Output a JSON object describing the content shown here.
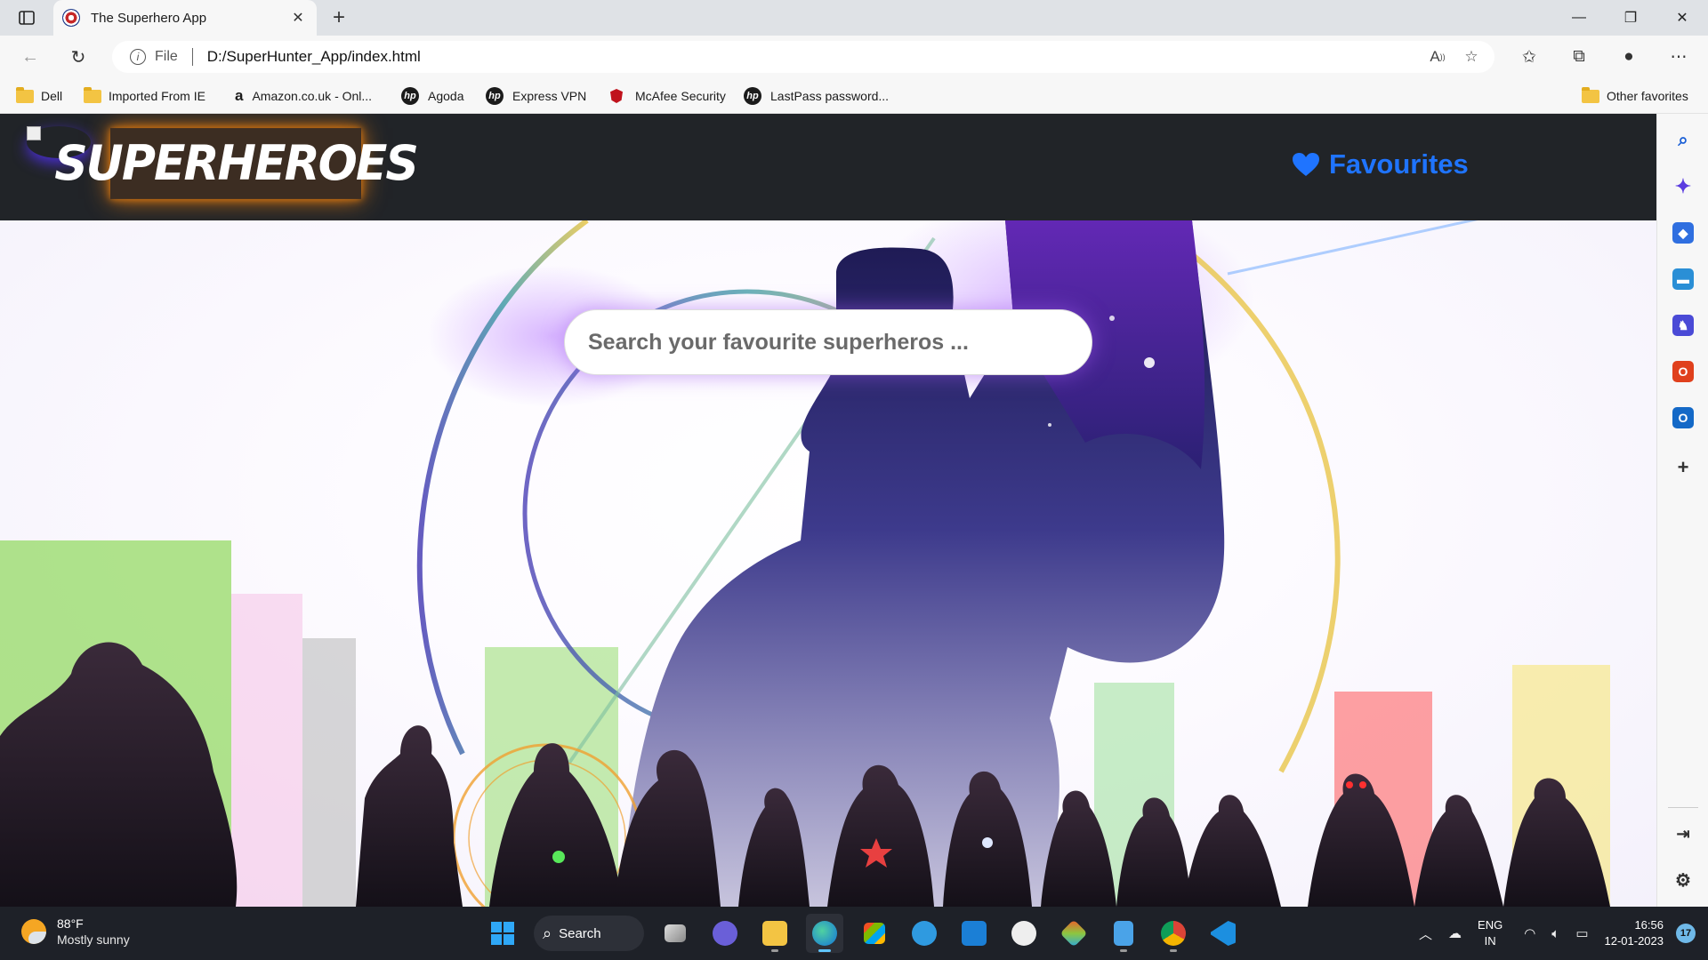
{
  "browser": {
    "tab": {
      "title": "The Superhero App"
    },
    "address": {
      "scheme": "File",
      "url": "D:/SuperHunter_App/index.html"
    },
    "favorites": [
      {
        "label": "Dell",
        "icon": "folder-icon"
      },
      {
        "label": "Imported From IE",
        "icon": "folder-icon"
      },
      {
        "label": "Amazon.co.uk - Onl...",
        "icon": "amazon-icon"
      },
      {
        "label": "Agoda",
        "icon": "hp-icon"
      },
      {
        "label": "Express VPN",
        "icon": "hp-icon"
      },
      {
        "label": "McAfee Security",
        "icon": "mcafee-icon"
      },
      {
        "label": "LastPass password...",
        "icon": "hp-icon"
      }
    ],
    "other_favorites": "Other favorites"
  },
  "site": {
    "logo_text": "SUPERHEROES",
    "favourites_label": "Favourites",
    "search_placeholder": "Search your favourite superheros ...",
    "colors": {
      "header_bg": "#212428",
      "accent_blue": "#1f74ff",
      "logo_glow": "#e07a10"
    }
  },
  "taskbar": {
    "weather_temp": "88°F",
    "weather_desc": "Mostly sunny",
    "search_label": "Search",
    "lang_top": "ENG",
    "lang_bottom": "IN",
    "time": "16:56",
    "date": "12-01-2023",
    "notification_count": "17"
  }
}
